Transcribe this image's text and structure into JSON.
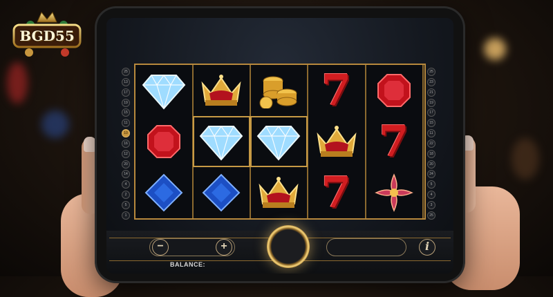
{
  "logo": {
    "text": "BGD55",
    "icon": "crown-icon"
  },
  "paylines_left": [
    "25",
    "13",
    "17",
    "19",
    "15",
    "11",
    "10",
    "16",
    "12",
    "20",
    "14",
    "4",
    "2",
    "5",
    "1"
  ],
  "paylines_right": [
    "25",
    "23",
    "21",
    "19",
    "17",
    "15",
    "11",
    "22",
    "18",
    "20",
    "24",
    "5",
    "4",
    "3",
    "25"
  ],
  "active_payline": "10",
  "reels": [
    [
      "diamond",
      "ruby",
      "sapphire"
    ],
    [
      "crown",
      "diamond",
      "sapphire"
    ],
    [
      "coins",
      "diamond",
      "crown"
    ],
    [
      "seven",
      "crown",
      "seven"
    ],
    [
      "ruby",
      "seven",
      "flower"
    ]
  ],
  "controls": {
    "minus_label": "−",
    "plus_label": "+",
    "info_label": "i",
    "balance_label": "BALANCE:"
  },
  "colors": {
    "gold": "#c79a45",
    "red_seven": "#d11d20",
    "accent": "#f4d27a"
  }
}
